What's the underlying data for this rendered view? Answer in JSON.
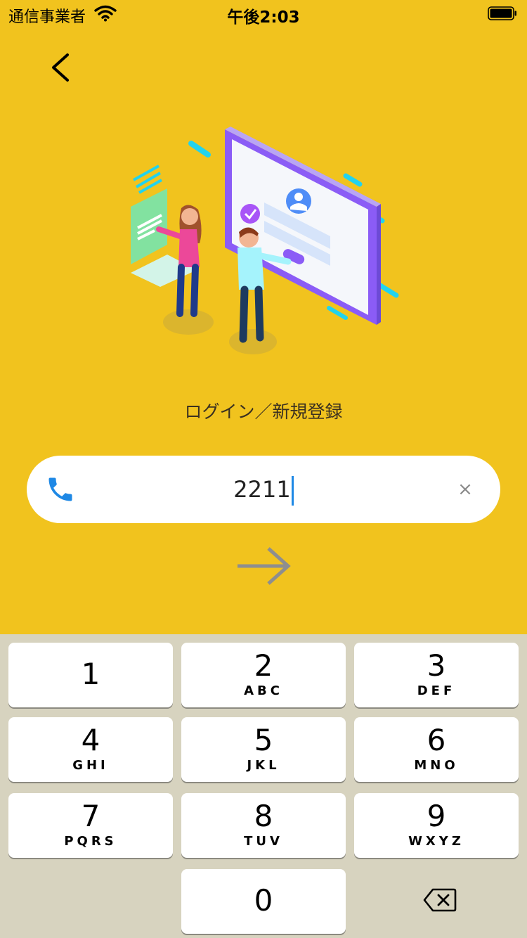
{
  "status_bar": {
    "carrier": "通信事業者",
    "time": "午後2:03"
  },
  "nav": {
    "back_icon": "chevron-left-icon"
  },
  "title": "ログイン／新規登録",
  "phone_input": {
    "value": "2211",
    "icon": "phone-icon",
    "clear": "×"
  },
  "submit": {
    "icon": "arrow-right-icon"
  },
  "keypad": {
    "keys": [
      {
        "num": "1",
        "letters": ""
      },
      {
        "num": "2",
        "letters": "ABC"
      },
      {
        "num": "3",
        "letters": "DEF"
      },
      {
        "num": "4",
        "letters": "GHI"
      },
      {
        "num": "5",
        "letters": "JKL"
      },
      {
        "num": "6",
        "letters": "MNO"
      },
      {
        "num": "7",
        "letters": "PQRS"
      },
      {
        "num": "8",
        "letters": "TUV"
      },
      {
        "num": "9",
        "letters": "WXYZ"
      },
      {
        "num": "0",
        "letters": ""
      }
    ],
    "delete_icon": "backspace-icon"
  },
  "colors": {
    "background": "#F1C31E",
    "accent": "#1E88E5",
    "keyboard": "#D7D3BF"
  }
}
